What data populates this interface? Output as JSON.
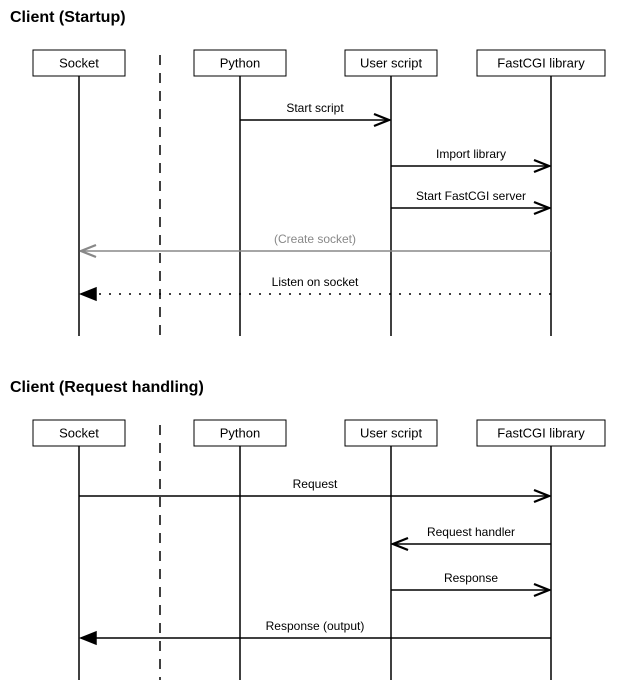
{
  "diagram1": {
    "title": "Client (Startup)",
    "actors": [
      "Socket",
      "Python",
      "User script",
      "FastCGI library"
    ],
    "messages": {
      "m1": "Start script",
      "m2": "Import library",
      "m3": "Start FastCGI server",
      "m4": "(Create socket)",
      "m5": "Listen on socket"
    }
  },
  "diagram2": {
    "title": "Client (Request handling)",
    "actors": [
      "Socket",
      "Python",
      "User script",
      "FastCGI library"
    ],
    "messages": {
      "m1": "Request",
      "m2": "Request handler",
      "m3": "Response",
      "m4": "Response (output)"
    }
  },
  "chart_data": [
    {
      "type": "sequence-diagram",
      "title": "Client (Startup)",
      "participants": [
        "Socket",
        "Python",
        "User script",
        "FastCGI library"
      ],
      "messages": [
        {
          "from": "Python",
          "to": "User script",
          "label": "Start script",
          "style": "solid-open"
        },
        {
          "from": "User script",
          "to": "FastCGI library",
          "label": "Import library",
          "style": "solid-open"
        },
        {
          "from": "User script",
          "to": "FastCGI library",
          "label": "Start FastCGI server",
          "style": "solid-open"
        },
        {
          "from": "FastCGI library",
          "to": "Socket",
          "label": "(Create socket)",
          "style": "solid-open-gray"
        },
        {
          "from": "FastCGI library",
          "to": "Socket",
          "label": "Listen on socket",
          "style": "dotted-filled"
        }
      ]
    },
    {
      "type": "sequence-diagram",
      "title": "Client (Request handling)",
      "participants": [
        "Socket",
        "Python",
        "User script",
        "FastCGI library"
      ],
      "messages": [
        {
          "from": "Socket",
          "to": "FastCGI library",
          "label": "Request",
          "style": "solid-open"
        },
        {
          "from": "FastCGI library",
          "to": "User script",
          "label": "Request handler",
          "style": "solid-open"
        },
        {
          "from": "User script",
          "to": "FastCGI library",
          "label": "Response",
          "style": "solid-open"
        },
        {
          "from": "FastCGI library",
          "to": "Socket",
          "label": "Response (output)",
          "style": "solid-filled"
        }
      ]
    }
  ]
}
